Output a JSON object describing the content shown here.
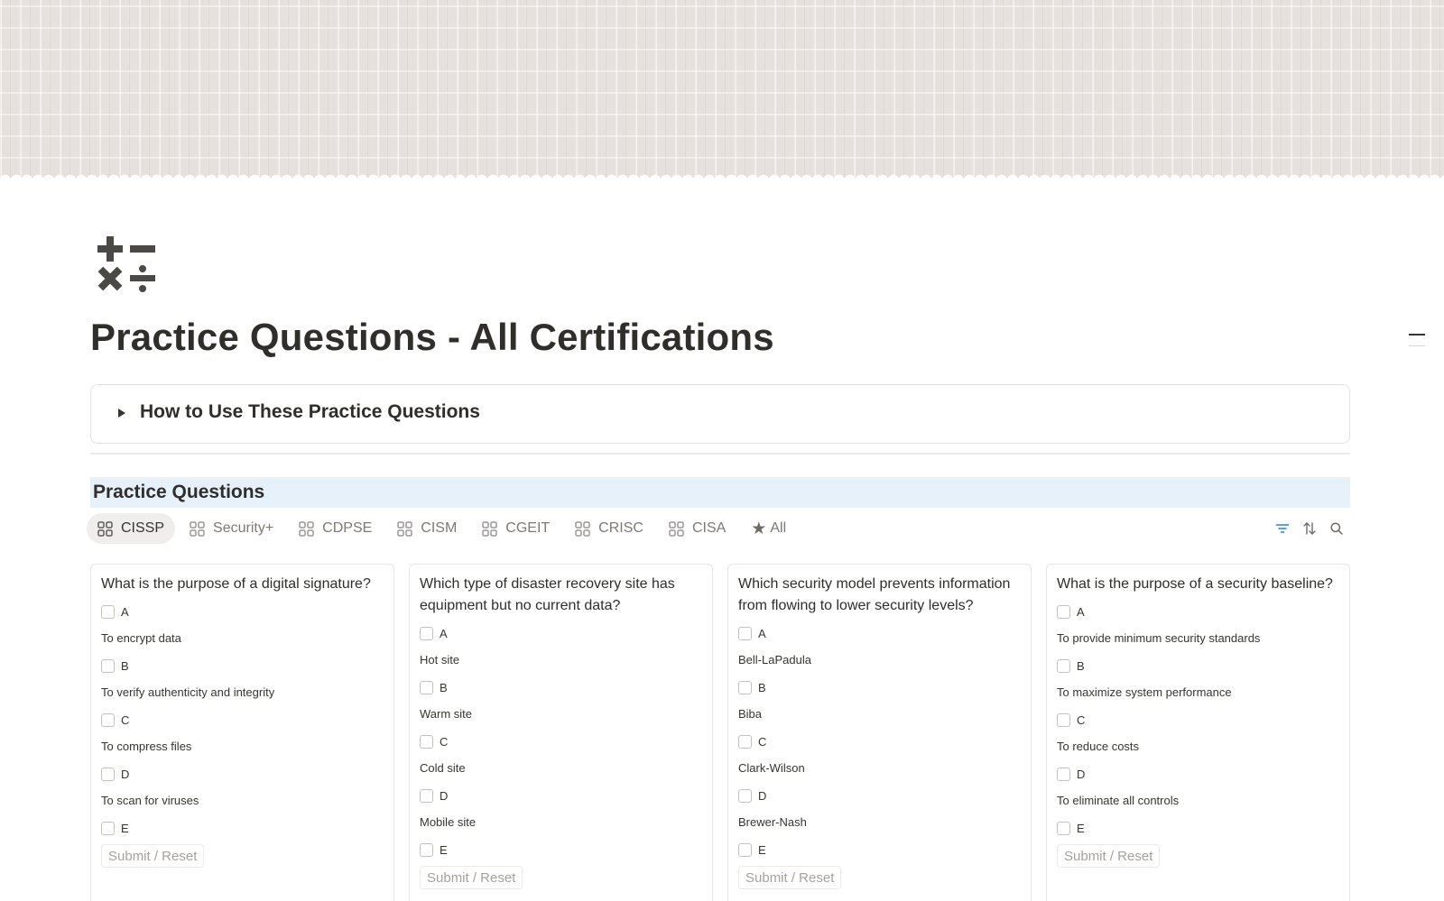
{
  "page": {
    "title": "Practice Questions - All Certifications",
    "icon": "calculator-symbols-icon",
    "toggle_label": "How to Use These Practice Questions",
    "section_heading": "Practice Questions"
  },
  "tabs": [
    {
      "label": "CISSP",
      "icon": "gallery-grid-icon",
      "active": true
    },
    {
      "label": "Security+",
      "icon": "gallery-grid-icon",
      "active": false
    },
    {
      "label": "CDPSE",
      "icon": "gallery-grid-icon",
      "active": false
    },
    {
      "label": "CISM",
      "icon": "gallery-grid-icon",
      "active": false
    },
    {
      "label": "CGEIT",
      "icon": "gallery-grid-icon",
      "active": false
    },
    {
      "label": "CRISC",
      "icon": "gallery-grid-icon",
      "active": false
    },
    {
      "label": "CISA",
      "icon": "gallery-grid-icon",
      "active": false
    },
    {
      "label": "All",
      "icon": "star-icon",
      "active": false
    }
  ],
  "toolbar": {
    "filter_icon": "filter-icon",
    "sort_icon": "sort-icon",
    "search_icon": "search-icon",
    "filter_color": "#2383e2"
  },
  "cards": [
    {
      "question": "What is the purpose of a digital signature?",
      "options": [
        {
          "letter": "A",
          "text": "To encrypt data"
        },
        {
          "letter": "B",
          "text": "To verify authenticity and integrity"
        },
        {
          "letter": "C",
          "text": "To compress files"
        },
        {
          "letter": "D",
          "text": "To scan for viruses"
        },
        {
          "letter": "E",
          "text": ""
        }
      ],
      "button": "Submit / Reset"
    },
    {
      "question": "Which type of disaster recovery site has equipment but no current data?",
      "options": [
        {
          "letter": "A",
          "text": "Hot site"
        },
        {
          "letter": "B",
          "text": "Warm site"
        },
        {
          "letter": "C",
          "text": "Cold site"
        },
        {
          "letter": "D",
          "text": "Mobile site"
        },
        {
          "letter": "E",
          "text": ""
        }
      ],
      "button": "Submit / Reset"
    },
    {
      "question": "Which security model prevents information from flowing to lower security levels?",
      "options": [
        {
          "letter": "A",
          "text": "Bell-LaPadula"
        },
        {
          "letter": "B",
          "text": "Biba"
        },
        {
          "letter": "C",
          "text": "Clark-Wilson"
        },
        {
          "letter": "D",
          "text": "Brewer-Nash"
        },
        {
          "letter": "E",
          "text": ""
        }
      ],
      "button": "Submit / Reset"
    },
    {
      "question": "What is the purpose of a security baseline?",
      "options": [
        {
          "letter": "A",
          "text": "To provide minimum security standards"
        },
        {
          "letter": "B",
          "text": "To maximize system performance"
        },
        {
          "letter": "C",
          "text": "To reduce costs"
        },
        {
          "letter": "D",
          "text": "To eliminate all controls"
        },
        {
          "letter": "E",
          "text": ""
        }
      ],
      "button": "Submit / Reset"
    }
  ]
}
